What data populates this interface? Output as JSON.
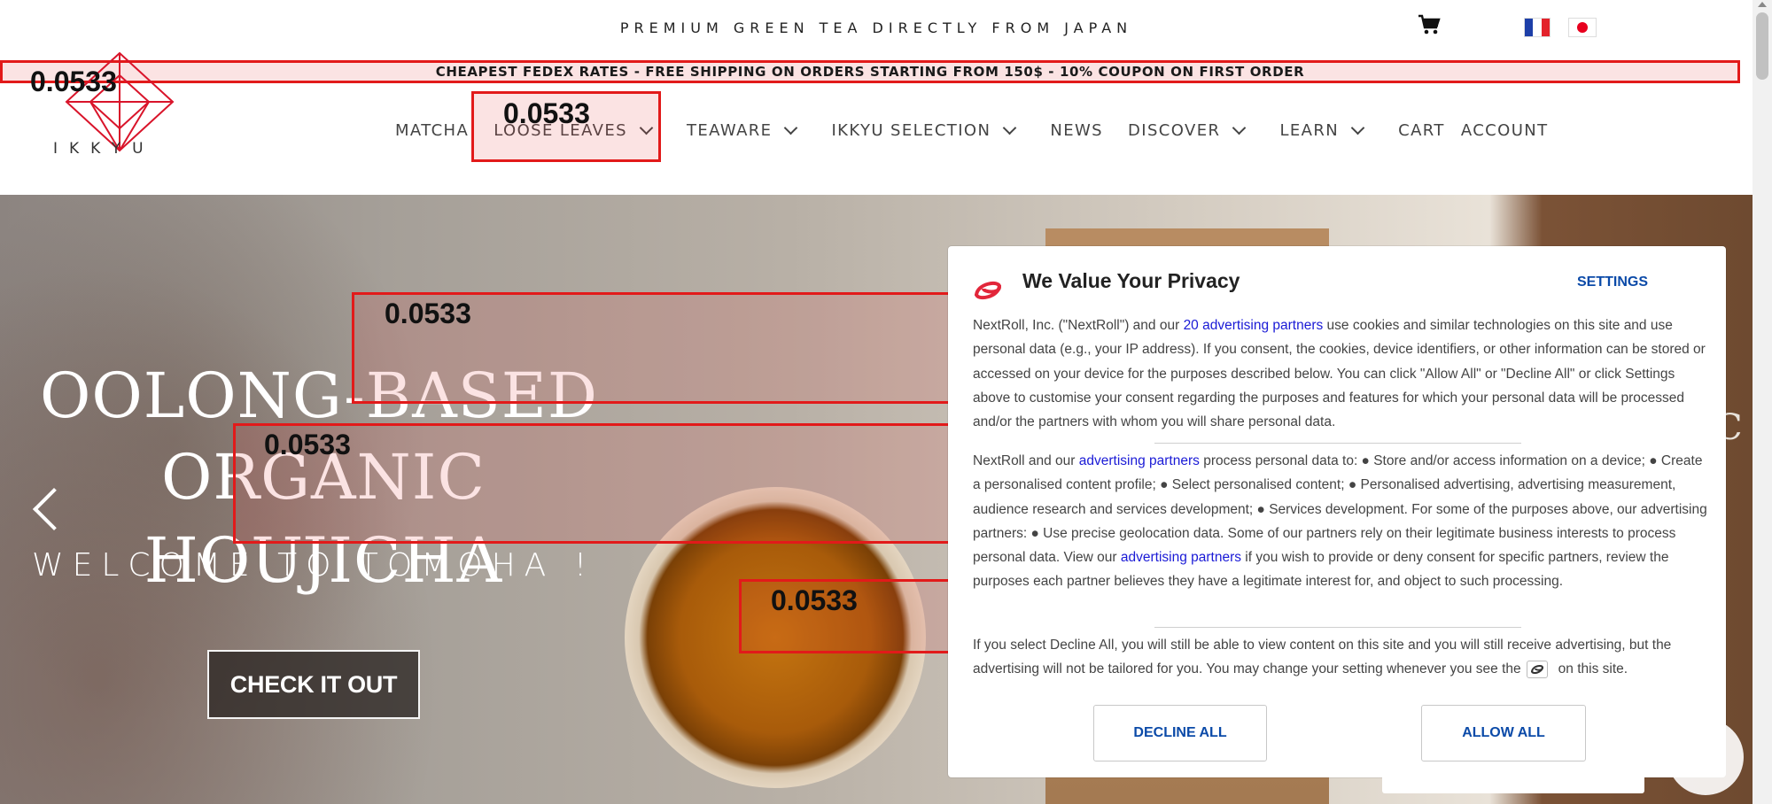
{
  "top": {
    "tagline": "PREMIUM GREEN TEA DIRECTLY FROM JAPAN",
    "icons": [
      "cart-icon",
      "flag-france-icon",
      "flag-japan-icon"
    ]
  },
  "shipping_banner": "CHEAPEST FEDEX RATES - FREE SHIPPING ON ORDERS STARTING FROM 150$ - 10% COUPON ON FIRST ORDER",
  "logo": {
    "word": "IKKYU"
  },
  "nav": {
    "matcha": "MATCHA",
    "loose_leaves": "LOOSE LEAVES",
    "teaware": "TEAWARE",
    "ikkyu_selection": "IKKYU SELECTION",
    "news": "NEWS",
    "discover": "DISCOVER",
    "learn": "LEARN",
    "cart": "CART",
    "account": "ACCOUNT"
  },
  "hero": {
    "title_line1": "OOLONG-BASED",
    "title_line2": "ORGANIC HOUJICHA",
    "subtitle": "WELCOME TO TOMOHA !",
    "cta": "CHECK IT OUT",
    "right_fragment": "C C"
  },
  "overlay_scores": {
    "logo": "0.0533",
    "nav": "0.0533",
    "hero_top": "0.0533",
    "hero_mid": "0.0533",
    "hero_cup": "0.0533"
  },
  "consent": {
    "title": "We Value Your Privacy",
    "settings": "SETTINGS",
    "p1_a": "NextRoll, Inc. (\"NextRoll\") and our ",
    "p1_link": "20 advertising partners",
    "p1_b": " use cookies and similar technologies on this site and use personal data (e.g., your IP address). If you consent, the cookies, device identifiers, or other information can be stored or accessed on your device for the purposes described below. You can click \"Allow All\" or \"Decline All\" or click Settings above to customise your consent regarding the purposes and features for which your personal data will be processed and/or the partners with whom you will share personal data.",
    "p2_a": "NextRoll and our ",
    "p2_link1": "advertising partners",
    "p2_b": " process personal data to: ● Store and/or access information on a device; ● Create a personalised content profile; ● Select personalised content; ● Personalised advertising, advertising measurement, audience research and services development; ● Services development. For some of the purposes above, our advertising partners: ● Use precise geolocation data. Some of our partners rely on their legitimate business interests to process personal data. View our ",
    "p2_link2": "advertising partners",
    "p2_c": " if you wish to provide or deny consent for specific partners, review the purposes each partner believes they have a legitimate interest for, and object to such processing.",
    "p3_a": "If you select Decline All, you will still be able to view content on this site and you will still receive advertising, but the advertising will not be tailored for you. You may change your setting whenever you see the",
    "p3_b": "on this site.",
    "decline": "DECLINE ALL",
    "allow": "ALLOW ALL"
  },
  "colors": {
    "highlight": "#e21a1a",
    "consent_link": "#1a1ad6",
    "consent_button_text": "#0b4aa8"
  }
}
